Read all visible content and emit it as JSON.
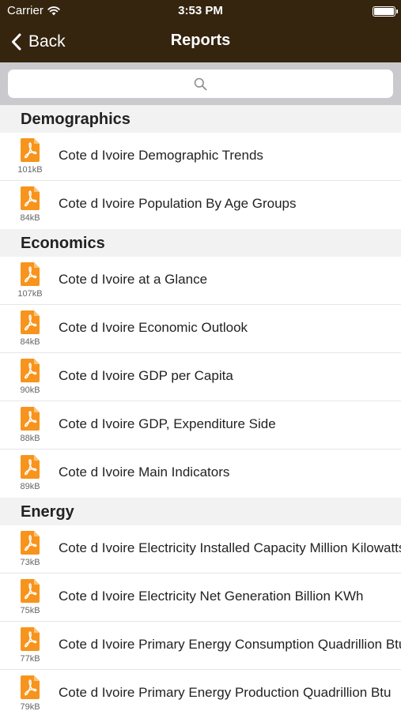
{
  "status_bar": {
    "carrier": "Carrier",
    "time": "3:53 PM"
  },
  "nav": {
    "back_label": "Back",
    "title": "Reports"
  },
  "search": {
    "placeholder": ""
  },
  "colors": {
    "nav_background": "#35250f",
    "pdf_icon": "#f7941d",
    "section_background": "#f2f2f3"
  },
  "sections": [
    {
      "title": "Demographics",
      "items": [
        {
          "name": "Cote d Ivoire Demographic Trends",
          "size": "101kB",
          "icon": "pdf-icon"
        },
        {
          "name": "Cote d Ivoire Population By Age Groups",
          "size": "84kB",
          "icon": "pdf-icon"
        }
      ]
    },
    {
      "title": "Economics",
      "items": [
        {
          "name": "Cote d Ivoire at a Glance",
          "size": "107kB",
          "icon": "pdf-icon"
        },
        {
          "name": "Cote d Ivoire Economic Outlook",
          "size": "84kB",
          "icon": "pdf-icon"
        },
        {
          "name": "Cote d Ivoire GDP per Capita",
          "size": "90kB",
          "icon": "pdf-icon"
        },
        {
          "name": "Cote d Ivoire GDP, Expenditure Side",
          "size": "88kB",
          "icon": "pdf-icon"
        },
        {
          "name": "Cote d Ivoire Main Indicators",
          "size": "89kB",
          "icon": "pdf-icon"
        }
      ]
    },
    {
      "title": "Energy",
      "items": [
        {
          "name": "Cote d Ivoire Electricity Installed Capacity Million Kilowatts",
          "size": "73kB",
          "icon": "pdf-icon"
        },
        {
          "name": "Cote d Ivoire Electricity Net Generation Billion KWh",
          "size": "75kB",
          "icon": "pdf-icon"
        },
        {
          "name": "Cote d Ivoire Primary Energy Consumption Quadrillion Btu",
          "size": "77kB",
          "icon": "pdf-icon"
        },
        {
          "name": "Cote d Ivoire Primary Energy Production Quadrillion Btu",
          "size": "79kB",
          "icon": "pdf-icon"
        }
      ]
    }
  ]
}
